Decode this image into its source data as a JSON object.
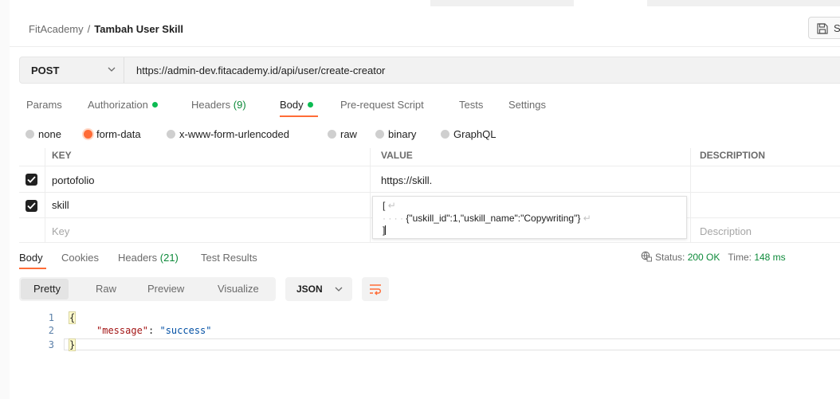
{
  "header": {
    "breadcrumb_parent": "FitAcademy",
    "breadcrumb_sep": "/",
    "breadcrumb_current": "Tambah User Skill",
    "save_label": "S"
  },
  "request": {
    "method": "POST",
    "url": "https://admin-dev.fitacademy.id/api/user/create-creator"
  },
  "request_tabs": [
    {
      "label": "Params"
    },
    {
      "label": "Authorization"
    },
    {
      "label": "Headers",
      "count": "(9)"
    },
    {
      "label": "Body"
    },
    {
      "label": "Pre-request Script"
    },
    {
      "label": "Tests"
    },
    {
      "label": "Settings"
    }
  ],
  "body_types": [
    {
      "label": "none"
    },
    {
      "label": "form-data",
      "selected": true
    },
    {
      "label": "x-www-form-urlencoded"
    },
    {
      "label": "raw"
    },
    {
      "label": "binary"
    },
    {
      "label": "GraphQL"
    }
  ],
  "params_table": {
    "headers": {
      "key": "KEY",
      "value": "VALUE",
      "description": "DESCRIPTION"
    },
    "rows": [
      {
        "checked": true,
        "key": "portofolio",
        "value": "https://skill."
      },
      {
        "checked": true,
        "key": "skill"
      }
    ],
    "new_row": {
      "key_placeholder": "Key",
      "description_placeholder": "Description"
    },
    "value_editor": {
      "line1": "[",
      "line2": "{\"uskill_id\":1,\"uskill_name\":\"Copywriting\"}",
      "line3": "]",
      "newline_glyph": "↵",
      "indent_glyph": "· · · ·"
    }
  },
  "response_tabs": [
    {
      "label": "Body"
    },
    {
      "label": "Cookies"
    },
    {
      "label": "Headers",
      "count": "(21)"
    },
    {
      "label": "Test Results"
    }
  ],
  "response_status": {
    "status_label": "Status:",
    "status_value": "200 OK",
    "time_label": "Time:",
    "time_value": "148 ms"
  },
  "response_views": {
    "options": [
      "Pretty",
      "Raw",
      "Preview",
      "Visualize"
    ],
    "format": "JSON"
  },
  "response_body": {
    "line_numbers": [
      "1",
      "2",
      "3"
    ],
    "open_brace": "{",
    "close_brace": "}",
    "key": "\"message\"",
    "colon": ": ",
    "value": "\"success\""
  },
  "colors": {
    "accent": "#ff6c37",
    "success": "#0cbb52"
  }
}
